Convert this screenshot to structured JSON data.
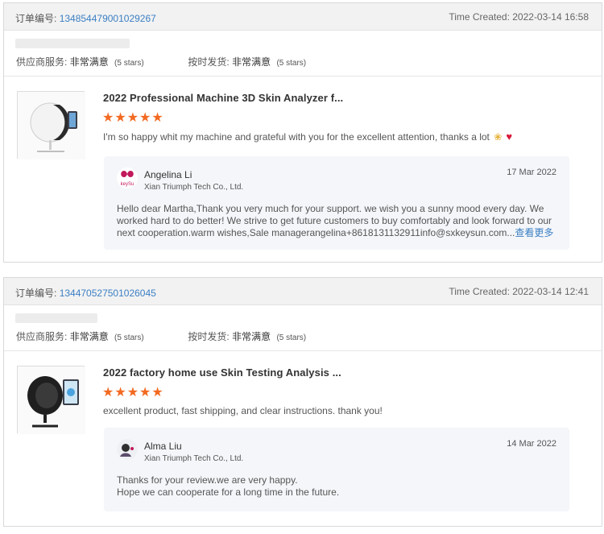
{
  "reviews": [
    {
      "order_label": "订单编号:",
      "order_number": "134854479001029267",
      "time_created": "Time Created: 2022-03-14 16:58",
      "supplier_service_label": "供应商服务:",
      "supplier_service_value": "非常满意",
      "supplier_service_stars": "(5 stars)",
      "shipping_label": "按时发货:",
      "shipping_value": "非常满意",
      "shipping_stars": "(5 stars)",
      "product_title": "2022 Professional Machine 3D Skin Analyzer f...",
      "stars": "★★★★★",
      "rating": 5,
      "review": "I'm so happy  whit my machine and grateful with you for the excellent attention, thanks a lot",
      "review_emoji_icons": [
        "folded-hands-icon",
        "red-heart-icon"
      ],
      "reply": {
        "name": "Angelina Li",
        "company": "Xian Triumph Tech Co., Ltd.",
        "date": "17 Mar 2022",
        "avatar_text": "keySu",
        "body": "Hello dear Martha,Thank you very much for your support. we wish you a sunny mood every day. We worked hard to do better! We strive to get future customers to buy comfortably and look forward to our next cooperation.warm wishes,Sale managerangelina+8618131132911info@sxkeysun.com...",
        "see_more": "查看更多"
      }
    },
    {
      "order_label": "订单编号:",
      "order_number": "134470527501026045",
      "time_created": "Time Created: 2022-03-14 12:41",
      "supplier_service_label": "供应商服务:",
      "supplier_service_value": "非常满意",
      "supplier_service_stars": "(5 stars)",
      "shipping_label": "按时发货:",
      "shipping_value": "非常满意",
      "shipping_stars": "(5 stars)",
      "product_title": "2022 factory home use Skin Testing Analysis ...",
      "stars": "★★★★★",
      "rating": 5,
      "review": "excellent product, fast shipping, and clear instructions. thank you!",
      "reply": {
        "name": "Alma Liu",
        "company": "Xian Triumph Tech Co., Ltd.",
        "date": "14 Mar 2022",
        "body_line1": "Thanks for your review.we are very happy.",
        "body_line2": "Hope we can cooperate for a long time in the future."
      }
    }
  ],
  "colors": {
    "link": "#3b7fc4",
    "star": "#f26a21",
    "header_bg": "#f2f2f2",
    "reply_bg": "#f4f6f9"
  }
}
